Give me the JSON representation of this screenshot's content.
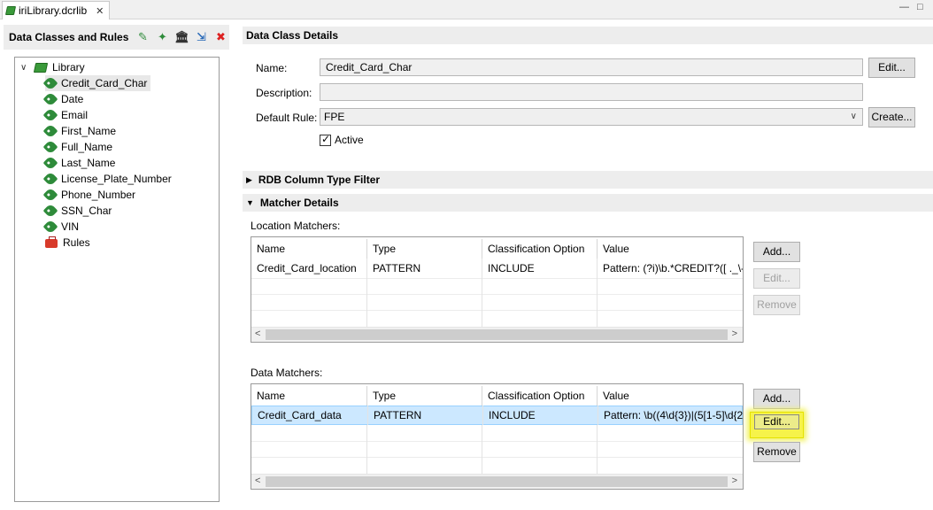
{
  "editor_tab": {
    "label": "iriLibrary.dcrlib",
    "close": "✕"
  },
  "window_controls": {
    "minimize": "—",
    "maximize": "□"
  },
  "left_panel": {
    "title": "Data Classes and Rules",
    "tree": {
      "root": "Library",
      "items": [
        "Credit_Card_Char",
        "Date",
        "Email",
        "First_Name",
        "Full_Name",
        "Last_Name",
        "License_Plate_Number",
        "Phone_Number",
        "SSN_Char",
        "VIN"
      ],
      "rules": "Rules",
      "selected": "Credit_Card_Char"
    }
  },
  "details": {
    "header": "Data Class Details",
    "name_label": "Name:",
    "name_value": "Credit_Card_Char",
    "description_label": "Description:",
    "description_value": "",
    "default_rule_label": "Default Rule:",
    "default_rule_value": "FPE",
    "active_label": "Active",
    "edit_button": "Edit...",
    "create_button": "Create..."
  },
  "rdb_filter": {
    "header": "RDB Column Type Filter"
  },
  "matcher_details": {
    "header": "Matcher Details",
    "location": {
      "label": "Location Matchers:",
      "columns": [
        "Name",
        "Type",
        "Classification Option",
        "Value"
      ],
      "rows": [
        [
          "Credit_Card_location",
          "PATTERN",
          "INCLUDE",
          "Pattern: (?i)\\b.*CREDIT?([ ._\\-\\"
        ]
      ]
    },
    "data": {
      "label": "Data Matchers:",
      "columns": [
        "Name",
        "Type",
        "Classification Option",
        "Value"
      ],
      "rows": [
        [
          "Credit_Card_data",
          "PATTERN",
          "INCLUDE",
          "Pattern: \\b((4\\d{3})|(5[1-5]\\d{2"
        ]
      ]
    },
    "buttons": {
      "add": "Add...",
      "edit": "Edit...",
      "remove": "Remove"
    }
  },
  "colors": {
    "highlight": "#f6f34a",
    "selection": "#cce8ff",
    "tag_green": "#2e8b3a"
  }
}
